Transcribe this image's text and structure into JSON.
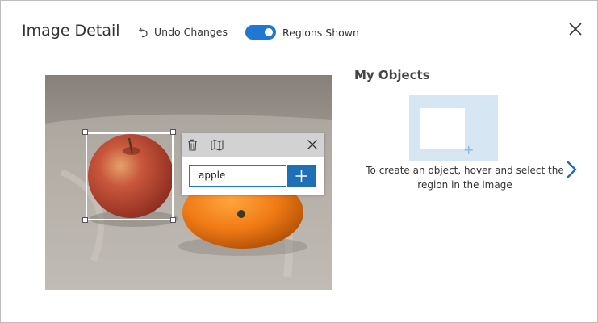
{
  "header": {
    "title": "Image Detail",
    "undo_label": "Undo Changes",
    "toggle_label": "Regions Shown",
    "toggle_on": true
  },
  "tag_editor": {
    "input_value": "apple"
  },
  "objects_panel": {
    "heading": "My Objects",
    "hint": "To create an object, hover and select the region in the image"
  },
  "colors": {
    "accent": "#1f78d1",
    "placeholder_bg": "#d6e6f3"
  },
  "icons": [
    "undo-icon",
    "close-icon",
    "trash-icon",
    "map-icon",
    "plus-icon",
    "chevron-right-icon"
  ]
}
